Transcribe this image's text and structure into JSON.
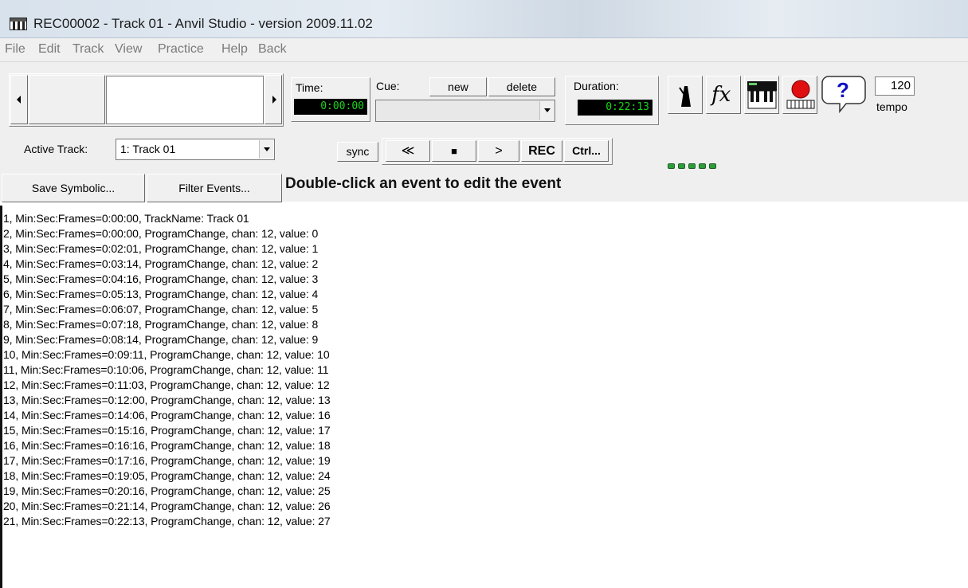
{
  "window": {
    "title": "REC00002 - Track 01 - Anvil Studio - version 2009.11.02",
    "icon": "piano-keys-icon"
  },
  "menu": [
    "File",
    "Edit",
    "Track",
    "View",
    "Practice",
    "Help",
    "Back"
  ],
  "time": {
    "label": "Time:",
    "value": "0:00:00"
  },
  "cue": {
    "label": "Cue:",
    "new_label": "new",
    "delete_label": "delete",
    "value": ""
  },
  "duration": {
    "label": "Duration:",
    "value": "0:22:13"
  },
  "tools": {
    "metronome_icon": "metronome-icon",
    "fx_label": "fx",
    "keyboard_icon": "keyboard-icon",
    "record_icon": "record-keyboard-icon",
    "help_label": "?",
    "tempo_value": "120",
    "tempo_label": "tempo"
  },
  "active_track": {
    "label": "Active Track:",
    "value": "1: Track 01"
  },
  "transport": {
    "sync_label": "sync",
    "rewind_label": "≪",
    "stop_label": "■",
    "play_label": ">",
    "rec_label": "REC",
    "ctrl_label": "Ctrl..."
  },
  "actions": {
    "save_symbolic_label": "Save Symbolic...",
    "filter_events_label": "Filter Events...",
    "hint": "Double-click an event to edit the event"
  },
  "colors": {
    "lcd_text": "#1bd51b",
    "lcd_bg": "#000000",
    "led": "#2e9c3a",
    "record": "#e01010",
    "help": "#1010c0"
  },
  "events": [
    "1, Min:Sec:Frames=0:00:00, TrackName: Track 01",
    "2, Min:Sec:Frames=0:00:00, ProgramChange, chan: 12, value: 0",
    "3, Min:Sec:Frames=0:02:01, ProgramChange, chan: 12, value: 1",
    "4, Min:Sec:Frames=0:03:14, ProgramChange, chan: 12, value: 2",
    "5, Min:Sec:Frames=0:04:16, ProgramChange, chan: 12, value: 3",
    "6, Min:Sec:Frames=0:05:13, ProgramChange, chan: 12, value: 4",
    "7, Min:Sec:Frames=0:06:07, ProgramChange, chan: 12, value: 5",
    "8, Min:Sec:Frames=0:07:18, ProgramChange, chan: 12, value: 8",
    "9, Min:Sec:Frames=0:08:14, ProgramChange, chan: 12, value: 9",
    "10, Min:Sec:Frames=0:09:11, ProgramChange, chan: 12, value: 10",
    "11, Min:Sec:Frames=0:10:06, ProgramChange, chan: 12, value: 11",
    "12, Min:Sec:Frames=0:11:03, ProgramChange, chan: 12, value: 12",
    "13, Min:Sec:Frames=0:12:00, ProgramChange, chan: 12, value: 13",
    "14, Min:Sec:Frames=0:14:06, ProgramChange, chan: 12, value: 16",
    "15, Min:Sec:Frames=0:15:16, ProgramChange, chan: 12, value: 17",
    "16, Min:Sec:Frames=0:16:16, ProgramChange, chan: 12, value: 18",
    "17, Min:Sec:Frames=0:17:16, ProgramChange, chan: 12, value: 19",
    "18, Min:Sec:Frames=0:19:05, ProgramChange, chan: 12, value: 24",
    "19, Min:Sec:Frames=0:20:16, ProgramChange, chan: 12, value: 25",
    "20, Min:Sec:Frames=0:21:14, ProgramChange, chan: 12, value: 26",
    "21, Min:Sec:Frames=0:22:13, ProgramChange, chan: 12, value: 27"
  ]
}
